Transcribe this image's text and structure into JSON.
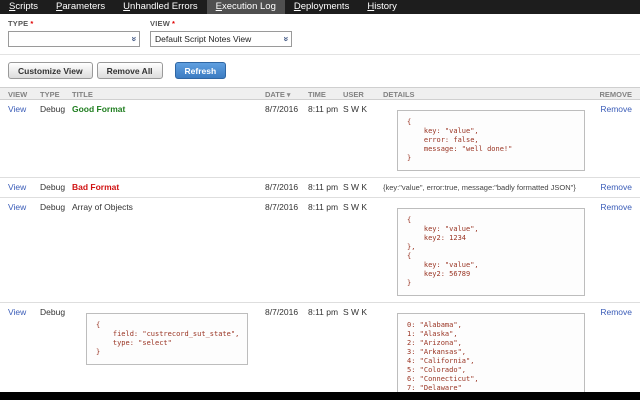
{
  "nav": {
    "items": [
      {
        "label": "Scripts",
        "active": false
      },
      {
        "label": "Parameters",
        "active": false
      },
      {
        "label": "Unhandled Errors",
        "active": false
      },
      {
        "label": "Execution Log",
        "active": true
      },
      {
        "label": "Deployments",
        "active": false
      },
      {
        "label": "History",
        "active": false
      }
    ]
  },
  "filters": {
    "type_label": "TYPE",
    "view_label": "VIEW",
    "required_marker": "*",
    "type_value": "",
    "view_value": "Default Script Notes View",
    "dropdown_icon": "»"
  },
  "toolbar": {
    "customize_view": "Customize View",
    "remove_all": "Remove All",
    "refresh": "Refresh"
  },
  "table": {
    "headers": {
      "view": "VIEW",
      "type": "TYPE",
      "title": "TITLE",
      "date": "DATE",
      "time": "TIME",
      "user": "USER",
      "details": "DETAILS",
      "remove": "REMOVE"
    },
    "sort_icon": "▾",
    "rows": [
      {
        "view": "View",
        "type": "Debug",
        "title": "Good Format",
        "date": "8/7/2016",
        "time": "8:11 pm",
        "user": "S W K",
        "details_code": "{\n    key: \"value\",\n    error: false,\n    message: \"well done!\"\n}",
        "remove": "Remove"
      },
      {
        "view": "View",
        "type": "Debug",
        "title": "Bad Format",
        "date": "8/7/2016",
        "time": "8:11 pm",
        "user": "S W K",
        "details_text": "{key:\"value\", error:true, message:\"badly formatted JSON\"}",
        "remove": "Remove"
      },
      {
        "view": "View",
        "type": "Debug",
        "title": "Array of Objects",
        "date": "8/7/2016",
        "time": "8:11 pm",
        "user": "S W K",
        "details_code": "{\n    key: \"value\",\n    key2: 1234\n},\n{\n    key: \"value\",\n    key2: 56789\n}",
        "remove": "Remove"
      },
      {
        "view": "View",
        "type": "Debug",
        "title_code": "{\n    field: \"custrecord_sut_state\",\n    type: \"select\"\n}",
        "date": "8/7/2016",
        "time": "8:11 pm",
        "user": "S W K",
        "details_code": "0: \"Alabama\",\n1: \"Alaska\",\n2: \"Arizona\",\n3: \"Arkansas\",\n4: \"California\",\n5: \"Colorado\",\n6: \"Connecticut\",\n7: \"Delaware\"",
        "remove": "Remove"
      }
    ]
  },
  "colors": {
    "refresh_button": "#3f7fc9",
    "good_title": "#1e7d1e",
    "bad_title": "#d01212",
    "link": "#3b5db8",
    "code_text": "#993322"
  }
}
